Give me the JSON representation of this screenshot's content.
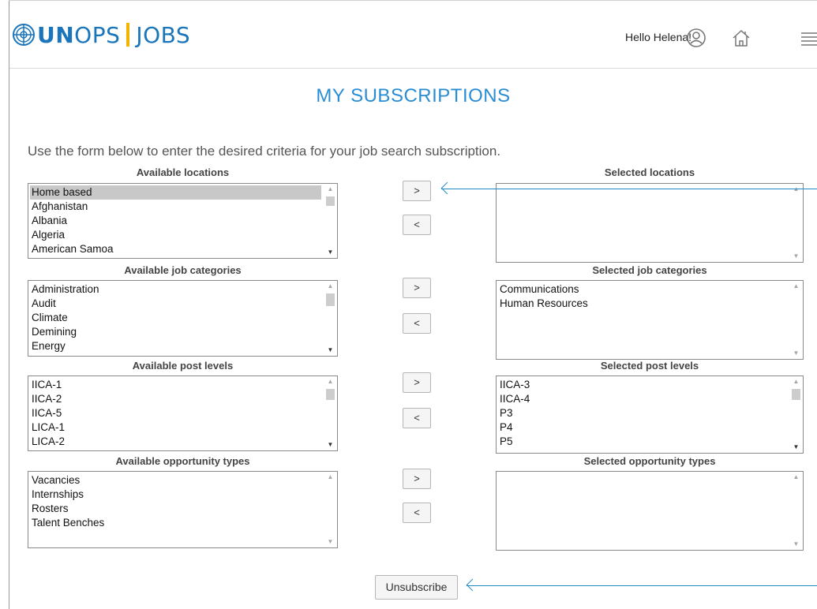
{
  "header": {
    "logo_un": "UN",
    "logo_ops": "OPS",
    "logo_jobs": "JOBS",
    "greeting": "Hello Helena!",
    "icons": [
      "user-circle-icon",
      "home-icon",
      "menu-icon"
    ]
  },
  "page": {
    "title": "MY SUBSCRIPTIONS",
    "intro": "Use the form below to enter the desired criteria for your job search subscription."
  },
  "buttons": {
    "add": ">",
    "remove": "<",
    "unsubscribe": "Unsubscribe"
  },
  "locations": {
    "available_label": "Available locations",
    "selected_label": "Selected locations",
    "available": [
      "Home based",
      "Afghanistan",
      "Albania",
      "Algeria",
      "American Samoa"
    ],
    "available_selected": "Home based",
    "selected": []
  },
  "job_categories": {
    "available_label": "Available job categories",
    "selected_label": "Selected job categories",
    "available": [
      "Administration",
      "Audit",
      "Climate",
      "Demining",
      "Energy"
    ],
    "selected": [
      "Communications",
      "Human Resources"
    ]
  },
  "post_levels": {
    "available_label": "Available post levels",
    "selected_label": "Selected post levels",
    "available": [
      "IICA-1",
      "IICA-2",
      "IICA-5",
      "LICA-1",
      "LICA-2"
    ],
    "selected": [
      "IICA-3",
      "IICA-4",
      "P3",
      "P4",
      "P5"
    ]
  },
  "opportunity_types": {
    "available_label": "Available opportunity types",
    "selected_label": "Selected opportunity types",
    "available": [
      "Vacancies",
      "Internships",
      "Rosters",
      "Talent Benches"
    ],
    "selected": []
  },
  "colors": {
    "brand_blue": "#1a75bb",
    "title_blue": "#2a8dd4",
    "logo_accent": "#f5b300",
    "callout": "#1d8ac4"
  }
}
